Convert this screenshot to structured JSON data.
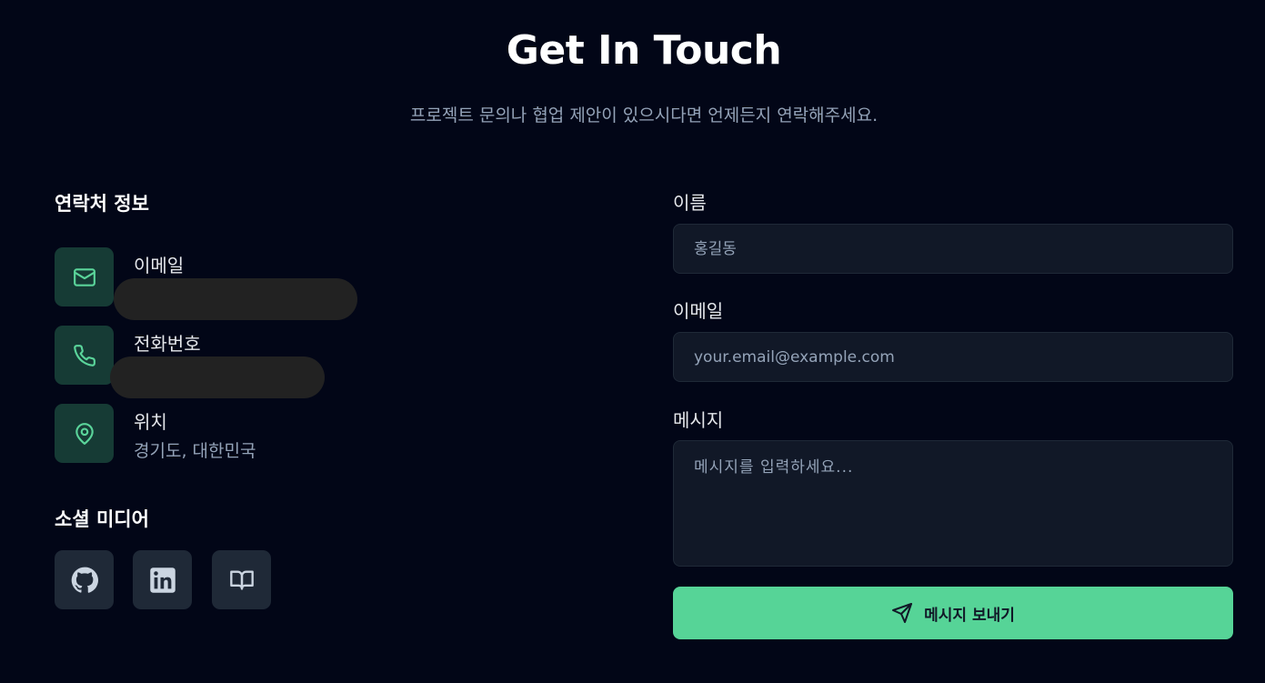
{
  "header": {
    "title": "Get In Touch",
    "subtitle": "프로젝트 문의나 협업 제안이 있으시다면 언제든지 연락해주세요."
  },
  "contact": {
    "heading": "연락처 정보",
    "items": [
      {
        "label": "이메일",
        "value": "",
        "icon": "mail-icon"
      },
      {
        "label": "전화번호",
        "value": "",
        "icon": "phone-icon"
      },
      {
        "label": "위치",
        "value": "경기도, 대한민국",
        "icon": "map-pin-icon"
      }
    ]
  },
  "social": {
    "heading": "소셜 미디어",
    "links": [
      {
        "icon": "github-icon"
      },
      {
        "icon": "linkedin-icon"
      },
      {
        "icon": "book-icon"
      }
    ]
  },
  "form": {
    "name_label": "이름",
    "name_placeholder": "홍길동",
    "email_label": "이메일",
    "email_placeholder": "your.email@example.com",
    "message_label": "메시지",
    "message_placeholder": "메시지를 입력하세요...",
    "submit_label": "메시지 보내기"
  },
  "colors": {
    "background": "#020617",
    "accent": "#56d497",
    "icon_bg": "#163b35",
    "social_bg": "#1f2937",
    "field_bg": "#111827"
  }
}
